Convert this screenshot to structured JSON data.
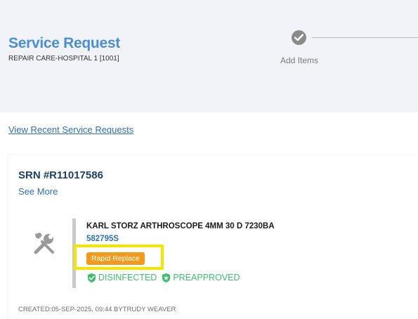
{
  "header": {
    "title": "Service Request",
    "subtitle": "REPAIR CARE-HOSPITAL 1 [1001]",
    "step_label": "Add Items"
  },
  "links": {
    "recent": "View Recent Service Requests"
  },
  "request": {
    "srn": "SRN #R11017586",
    "see_more": "See More",
    "item": {
      "name": "KARL STORZ ARTHROSCOPE 4MM 30 D 7230BA",
      "code": "582795S",
      "badge": "Rapid Replace",
      "status1": "DISINFECTED",
      "status2": "PREAPPROVED"
    },
    "created": "CREATED:05-SEP-2025, 09:44 BYTRUDY WEAVER"
  },
  "icons": {
    "step": "check-circle-icon",
    "item": "tools-icon",
    "status1": "check-circle-icon",
    "status2": "shield-star-icon"
  },
  "colors": {
    "title": "#4a8fd6",
    "link": "#2d6fb8",
    "badge": "#f29a1c",
    "highlight": "#f3e600",
    "status": "#3bbf6e"
  }
}
